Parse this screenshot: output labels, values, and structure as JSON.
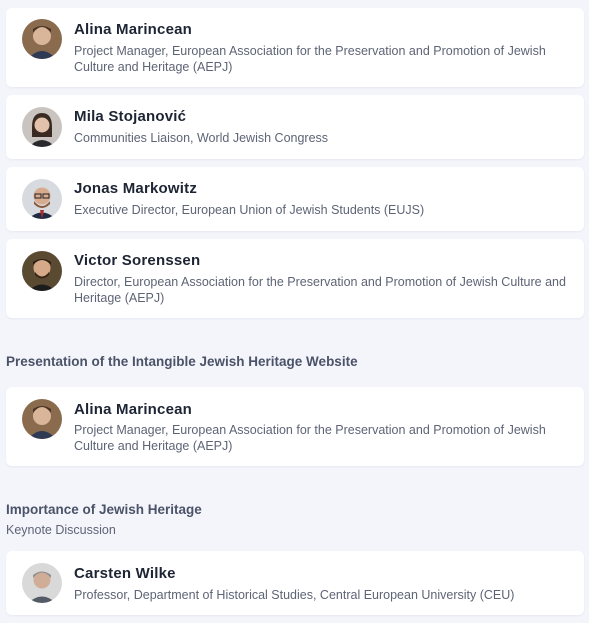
{
  "speakers_group_1": [
    {
      "name": "Alina Marincean",
      "role": "Project Manager, European Association for the Preservation and Promotion of Jewish Culture and Heritage (AEPJ)",
      "avatar": "alina-photo"
    },
    {
      "name": "Mila Stojanović",
      "role": "Communities Liaison, World Jewish Congress",
      "avatar": "mila-photo"
    },
    {
      "name": "Jonas Markowitz",
      "role": "Executive Director, European Union of Jewish Students (EUJS)",
      "avatar": "jonas-photo"
    },
    {
      "name": "Victor Sorenssen",
      "role": "Director, European Association for the Preservation and Promotion of Jewish Culture and Heritage (AEPJ)",
      "avatar": "victor-photo"
    }
  ],
  "section_2": {
    "title": "Presentation of the Intangible Jewish Heritage Website",
    "speakers": [
      {
        "name": "Alina Marincean",
        "role": "Project Manager, European Association for the Preservation and Promotion of Jewish Culture and Heritage (AEPJ)",
        "avatar": "alina-photo"
      }
    ]
  },
  "section_3": {
    "title": "Importance of Jewish Heritage",
    "subtitle": "Keynote Discussion",
    "speakers": [
      {
        "name": "Carsten Wilke",
        "role": "Professor, Department of Historical Studies, Central European University (CEU)",
        "avatar": "carsten-photo"
      }
    ]
  }
}
